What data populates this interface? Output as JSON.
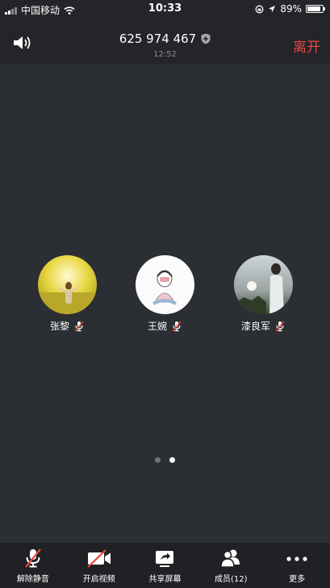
{
  "status_bar": {
    "carrier": "中国移动",
    "time": "10:33",
    "battery": "89%",
    "battery_level": 0.89
  },
  "header": {
    "meeting_id": "625 974 467",
    "duration": "12:52",
    "leave_label": "离开"
  },
  "participants": [
    {
      "name": "张黎",
      "muted": true
    },
    {
      "name": "王婉",
      "muted": true
    },
    {
      "name": "漆良军",
      "muted": true
    }
  ],
  "pagination": {
    "pages": 2,
    "current": 2
  },
  "toolbar": {
    "unmute_label": "解除静音",
    "video_label": "开启视频",
    "share_label": "共享屏幕",
    "members_label": "成员(12)",
    "more_label": "更多"
  },
  "colors": {
    "leave": "#e8463d",
    "mute_slash": "#e8463d",
    "background": "#2b2e32"
  }
}
